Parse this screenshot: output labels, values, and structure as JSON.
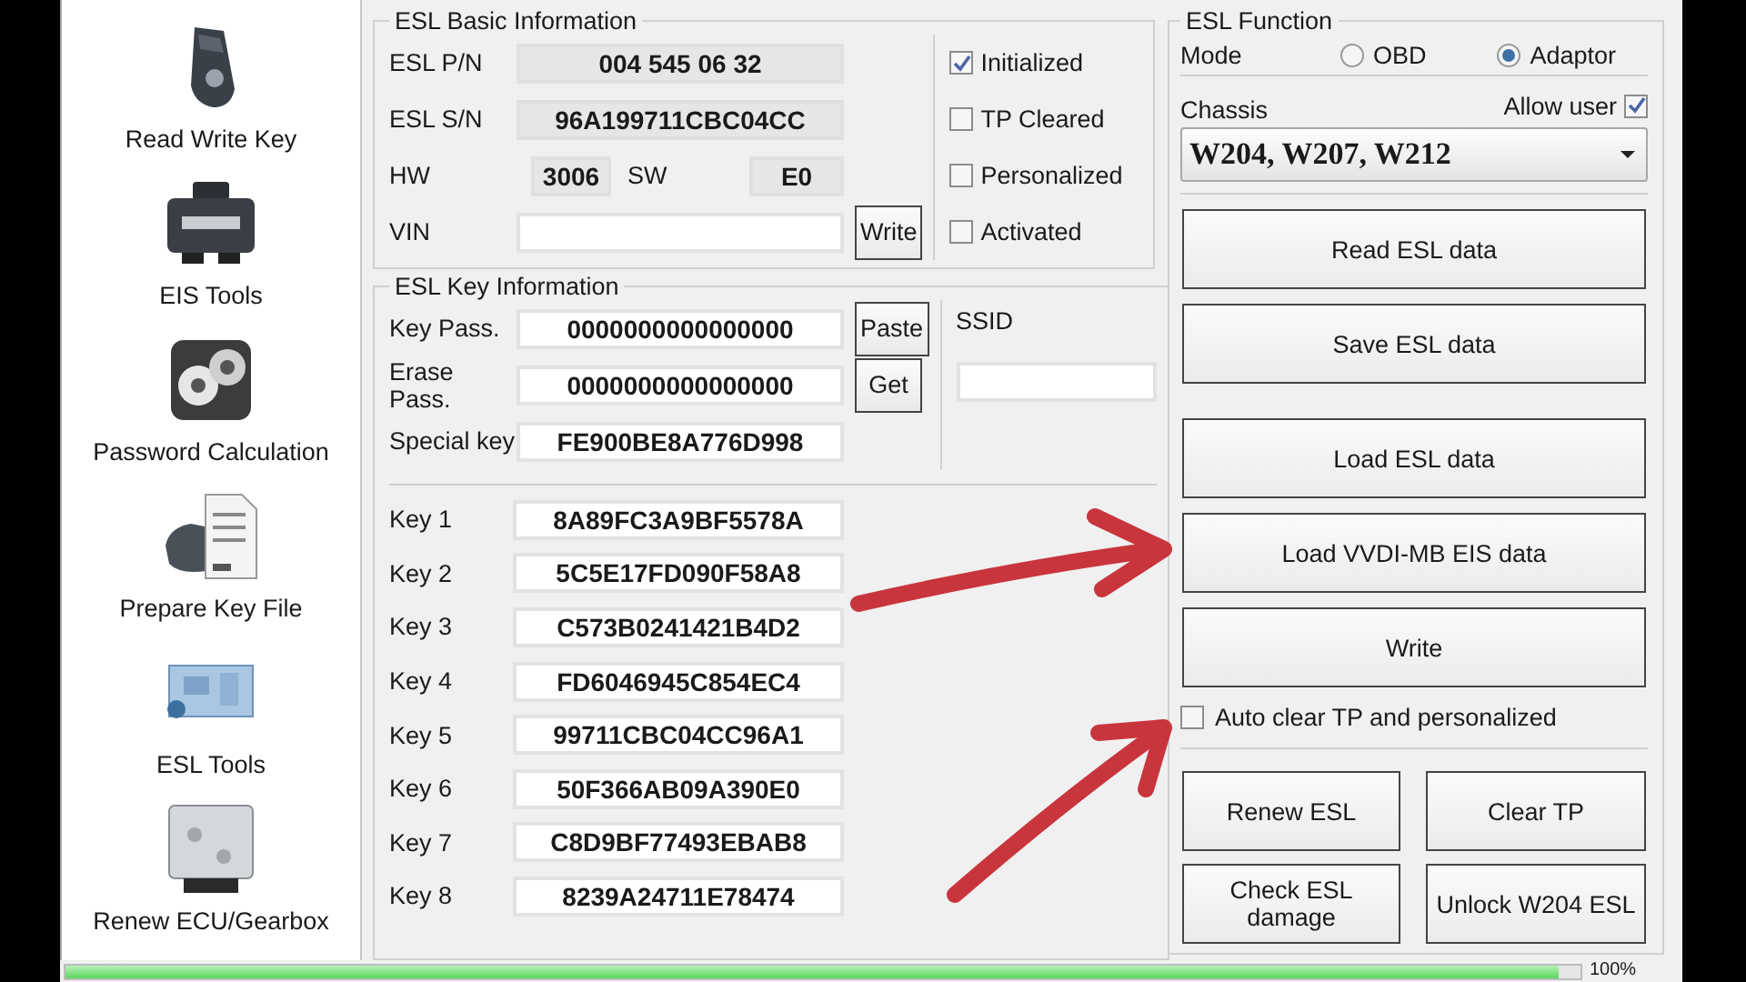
{
  "sidebar": {
    "items": [
      {
        "label": "Read Write Key",
        "kind": "fob"
      },
      {
        "label": "EIS Tools",
        "kind": "module"
      },
      {
        "label": "Password Calculation",
        "kind": "dial"
      },
      {
        "label": "Prepare Key File",
        "kind": "file"
      },
      {
        "label": "ESL Tools",
        "kind": "board"
      },
      {
        "label": "Renew ECU/Gearbox",
        "kind": "ecu"
      }
    ]
  },
  "basic_info": {
    "title": "ESL Basic Information",
    "pn_label": "ESL P/N",
    "pn": "004 545 06 32",
    "sn_label": "ESL S/N",
    "sn": "96A199711CBC04CC",
    "hw_label": "HW",
    "hw": "3006",
    "sw_label": "SW",
    "sw": "E0",
    "vin_label": "VIN",
    "write_button": "Write",
    "flags": [
      {
        "label": "Initialized",
        "checked": true
      },
      {
        "label": "TP Cleared",
        "checked": false
      },
      {
        "label": "Personalized",
        "checked": false
      },
      {
        "label": "Activated",
        "checked": false
      }
    ]
  },
  "key_info": {
    "title": "ESL Key Information",
    "key_pass_label": "Key Pass.",
    "key_pass": "0000000000000000",
    "paste_button": "Paste",
    "erase_pass_label": "Erase Pass.",
    "erase_pass": "0000000000000000",
    "get_button": "Get",
    "special_key_label": "Special key",
    "special_key": "FE900BE8A776D998",
    "ssid_label": "SSID",
    "keys": [
      {
        "label": "Key 1",
        "value": "8A89FC3A9BF5578A"
      },
      {
        "label": "Key 2",
        "value": "5C5E17FD090F58A8"
      },
      {
        "label": "Key 3",
        "value": "C573B0241421B4D2"
      },
      {
        "label": "Key 4",
        "value": "FD6046945C854EC4"
      },
      {
        "label": "Key 5",
        "value": "99711CBC04CC96A1"
      },
      {
        "label": "Key 6",
        "value": "50F366AB09A390E0"
      },
      {
        "label": "Key 7",
        "value": "C8D9BF77493EBAB8"
      },
      {
        "label": "Key 8",
        "value": "8239A24711E78474"
      }
    ]
  },
  "esl_function": {
    "title": "ESL Function",
    "mode_label": "Mode",
    "modes": [
      {
        "label": "OBD",
        "selected": false
      },
      {
        "label": "Adaptor",
        "selected": true
      }
    ],
    "chassis_label": "Chassis",
    "allow_user": {
      "label": "Allow user",
      "checked": true
    },
    "chassis_value": "W204, W207, W212",
    "buttons": [
      "Read ESL data",
      "Save ESL data",
      "Load ESL data",
      "Load VVDI-MB EIS data",
      "Write"
    ],
    "auto_clear": {
      "label": "Auto clear TP and personalized",
      "checked": false
    },
    "bottom_buttons": [
      "Renew ESL",
      "Clear TP",
      "Check ESL damage",
      "Unlock W204 ESL"
    ]
  },
  "progress": {
    "level": 0.985,
    "reading": "100%"
  }
}
